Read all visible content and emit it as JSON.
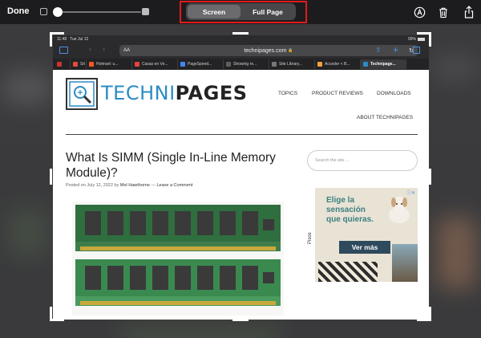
{
  "toolbar": {
    "done_label": "Done",
    "segments": [
      {
        "label": "Screen",
        "active": true
      },
      {
        "label": "Full Page",
        "active": false
      }
    ],
    "highlight_color": "#e01b1b"
  },
  "browser": {
    "status_time": "11:48",
    "status_date": "Tue Jul 12",
    "battery": "99%",
    "reader_label": "AA",
    "url": "technipages.com",
    "tabs": [
      {
        "label": "Sit",
        "color": "#e24b3b"
      },
      {
        "label": "Hotmart: u...",
        "color": "#f05a23"
      },
      {
        "label": "Casas en Ve...",
        "color": "#e8423f"
      },
      {
        "label": "PageSpeed...",
        "color": "#4285f4"
      },
      {
        "label": "Showing re...",
        "color": "#5e5e5e"
      },
      {
        "label": "Site Library...",
        "color": "#777777"
      },
      {
        "label": "Acceder < B...",
        "color": "#f2a33a"
      },
      {
        "label": "Technipage...",
        "color": "#2b8cc4"
      }
    ]
  },
  "site": {
    "logo_part1": "TECHNI",
    "logo_part2": "PAGES",
    "nav": [
      "TOPICS",
      "PRODUCT REVIEWS",
      "DOWNLOADS",
      "ABOUT TECHNIPAGES"
    ],
    "title": "What Is SIMM (Single In-Line Memory Module)?",
    "byline_prefix": "Posted on July 12, 2022 by",
    "author": "Mel Hawthorne",
    "sep": "—",
    "comment_link": "Leave a Comment",
    "search_placeholder": "Search the site ...",
    "ad": {
      "headline_1": "Elige la",
      "headline_2": "sensación",
      "headline_3": "que quieras.",
      "cta": "Ver más",
      "brand": "Pisos"
    }
  }
}
